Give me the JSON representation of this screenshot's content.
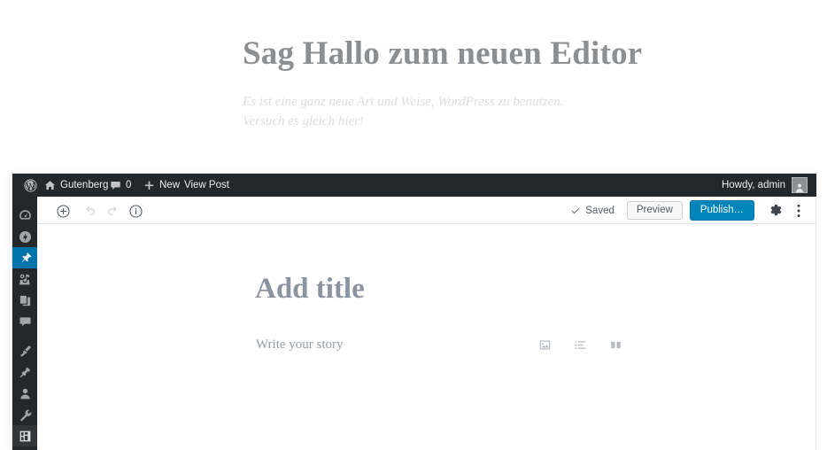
{
  "hero": {
    "title": "Sag Hallo zum neuen Editor",
    "subtitle": "Es ist eine ganz neue Art und Weise, WordPress zu benutzen. Versuch es gleich hier!"
  },
  "admin_bar": {
    "wp_logo_icon": "wordpress-logo-icon",
    "site_icon": "home-icon",
    "site_name": "Gutenberg",
    "comments_icon": "comment-bubble-icon",
    "comments_count": "0",
    "new_icon": "plus-icon",
    "new_label": "New",
    "view_post_label": "View Post",
    "howdy_label": "Howdy, admin",
    "avatar_icon": "user-avatar-icon"
  },
  "sidebar": {
    "items": [
      {
        "name": "dashboard",
        "icon": "dashboard-gauge-icon",
        "state": "default"
      },
      {
        "name": "gutenberg",
        "icon": "lightning-bolt-circle-icon",
        "state": "default"
      },
      {
        "name": "posts",
        "icon": "pin-icon",
        "state": "current"
      },
      {
        "name": "media",
        "icon": "media-camera-icon",
        "state": "default"
      },
      {
        "name": "pages",
        "icon": "pages-stack-icon",
        "state": "default"
      },
      {
        "name": "comments",
        "icon": "comment-bubble-icon",
        "state": "default"
      },
      {
        "name": "appearance",
        "icon": "paintbrush-icon",
        "state": "default"
      },
      {
        "name": "plugins",
        "icon": "plug-icon",
        "state": "default"
      },
      {
        "name": "users",
        "icon": "user-icon",
        "state": "default"
      },
      {
        "name": "tools",
        "icon": "wrench-icon",
        "state": "default"
      },
      {
        "name": "settings",
        "icon": "settings-sliders-icon",
        "state": "hovered"
      }
    ]
  },
  "editor_toolbar": {
    "inserter_icon": "plus-circle-icon",
    "undo_icon": "undo-arrow-icon",
    "redo_icon": "redo-arrow-icon",
    "info_icon": "info-circle-icon",
    "saved_icon": "checkmark-icon",
    "saved_label": "Saved",
    "preview_label": "Preview",
    "publish_label": "Publish…",
    "settings_icon": "gear-icon",
    "more_icon": "ellipsis-vertical-icon"
  },
  "editor": {
    "title_placeholder": "Add title",
    "block_placeholder": "Write your story",
    "quick_inserters": [
      {
        "name": "image-block",
        "icon": "image-icon"
      },
      {
        "name": "list-block",
        "icon": "list-icon"
      },
      {
        "name": "columns-block",
        "icon": "columns-icon"
      }
    ]
  },
  "colors": {
    "admin_dark": "#23282d",
    "admin_current": "#0073aa",
    "publish_blue": "#0085ba",
    "hero_title": "#8c8f91",
    "hero_subtitle": "#dcdde0",
    "editor_title": "#8a94a0"
  }
}
